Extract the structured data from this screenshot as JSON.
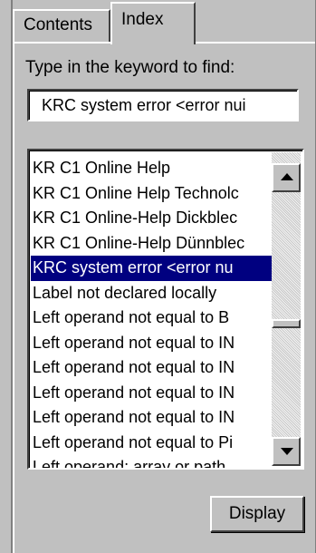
{
  "tabs": [
    {
      "label": "Contents",
      "selected": false
    },
    {
      "label": "Index",
      "selected": true
    }
  ],
  "prompt": "Type in the keyword to find:",
  "keyword_input": {
    "value": "KRC system error <error nui"
  },
  "list": {
    "items": [
      "KR C1 Online Help",
      "KR C1 Online Help Technolc",
      "KR C1 Online-Help Dickblec",
      "KR C1 Online-Help Dünnblec",
      "KRC system error <error nu",
      "Label not declared locally",
      "Left operand not equal to B",
      "Left operand not equal to IN",
      "Left operand not equal to IN",
      "Left operand not equal to IN",
      "Left operand not equal to IN",
      "Left operand not equal to Pi",
      "Left operand: array or path"
    ],
    "selected_index": 4
  },
  "display_button": "Display",
  "colors": {
    "selection": "#000080",
    "face": "#c0c0c0"
  }
}
